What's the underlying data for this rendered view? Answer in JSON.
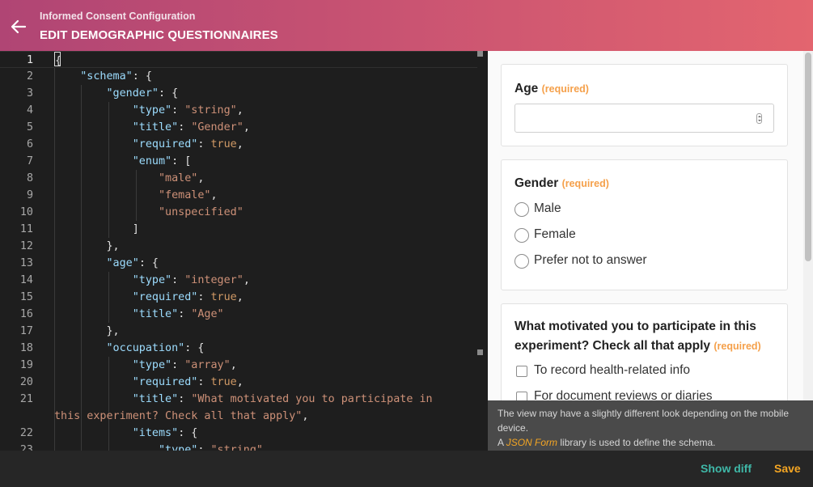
{
  "header": {
    "subtitle": "Informed Consent Configuration",
    "title": "EDIT DEMOGRAPHIC QUESTIONNAIRES"
  },
  "editor": {
    "line_numbers": [
      "1",
      "2",
      "3",
      "4",
      "5",
      "6",
      "7",
      "8",
      "9",
      "10",
      "11",
      "12",
      "13",
      "14",
      "15",
      "16",
      "17",
      "18",
      "19",
      "20",
      "21",
      "",
      "22",
      "23"
    ]
  },
  "preview": {
    "age": {
      "label": "Age",
      "required": "(required)",
      "value": ""
    },
    "gender": {
      "label": "Gender",
      "required": "(required)",
      "options": [
        "Male",
        "Female",
        "Prefer not to answer"
      ]
    },
    "motivation": {
      "label": "What motivated you to participate in this experiment? Check all that apply",
      "required": "(required)",
      "options": [
        "To record health-related info",
        "For document reviews or diaries"
      ]
    }
  },
  "notice": {
    "line1": "The view may have a slightly different look depending on the mobile device.",
    "prefix": "A ",
    "library": "JSON Form",
    "suffix": " library is used to define the schema."
  },
  "footer": {
    "show_diff": "Show diff",
    "save": "Save"
  },
  "colors": {
    "accent_orange": "#f5a623",
    "accent_teal": "#3fb8a8",
    "header_gradient_start": "#b04574",
    "header_gradient_end": "#e3656f"
  }
}
